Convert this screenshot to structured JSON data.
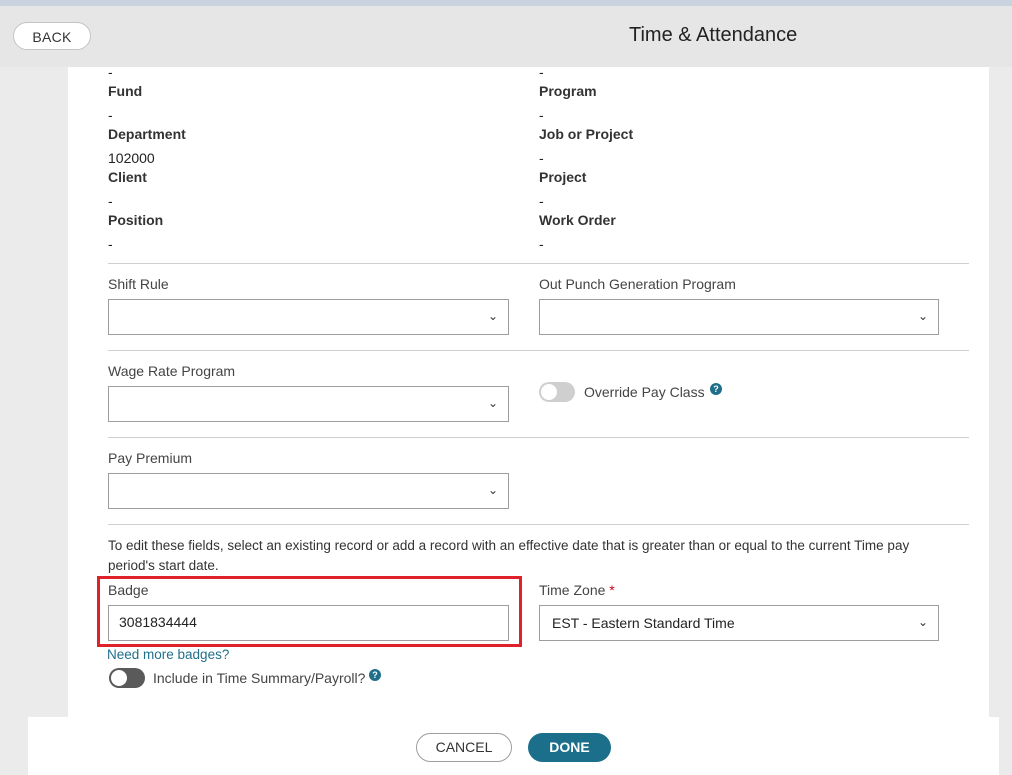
{
  "header": {
    "back_label": "BACK",
    "title": "Time & Attendance"
  },
  "fields_left": [
    {
      "value_above": "-",
      "label": "Fund"
    },
    {
      "value_above": "-",
      "label": "Department"
    },
    {
      "value_above": "102000",
      "label": "Client"
    },
    {
      "value_above": "-",
      "label": "Position"
    },
    {
      "value_above": "-"
    }
  ],
  "fields_right": [
    {
      "value_above": "-",
      "label": "Program"
    },
    {
      "value_above": "-",
      "label": "Job or Project"
    },
    {
      "value_above": "-",
      "label": "Project"
    },
    {
      "value_above": "-",
      "label": "Work Order"
    },
    {
      "value_above": "-"
    }
  ],
  "form": {
    "shift_rule_label": "Shift Rule",
    "out_punch_label": "Out Punch Generation Program",
    "wage_rate_label": "Wage Rate Program",
    "override_pay_class_label": "Override Pay Class",
    "pay_premium_label": "Pay Premium",
    "edit_note": "To edit these fields, select an existing record or add a record with an effective date that is greater than or equal to the current Time pay period's start date.",
    "badge_label": "Badge",
    "badge_value": "3081834444",
    "time_zone_label": "Time Zone",
    "time_zone_required": "*",
    "time_zone_value": "EST - Eastern Standard Time",
    "need_more_badges": "Need more badges?",
    "include_summary_label": "Include in Time Summary/Payroll?",
    "help_glyph": "?"
  },
  "footer": {
    "cancel_label": "CANCEL",
    "done_label": "DONE"
  },
  "colors": {
    "accent": "#1c6f8b",
    "highlight": "#e0202a",
    "required": "#d0021b"
  }
}
